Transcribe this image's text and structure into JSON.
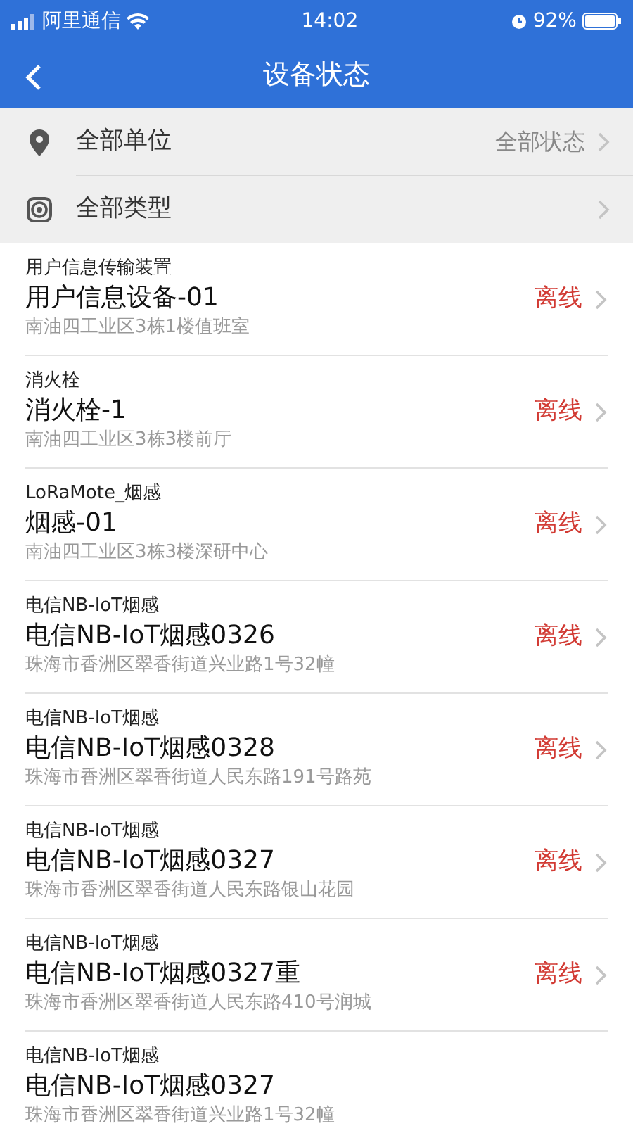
{
  "status_bar": {
    "carrier": "阿里通信",
    "time": "14:02",
    "battery": "92%"
  },
  "nav": {
    "title": "设备状态"
  },
  "filters": [
    {
      "kind": "location",
      "label": "全部单位",
      "value": "全部状态"
    },
    {
      "kind": "type",
      "label": "全部类型"
    }
  ],
  "devices": [
    {
      "type": "用户信息传输装置",
      "name": "用户信息设备-01",
      "address": "南油四工业区3栋1楼值班室",
      "status": "离线"
    },
    {
      "type": "消火栓",
      "name": "消火栓-1",
      "address": "南油四工业区3栋3楼前厅",
      "status": "离线"
    },
    {
      "type": "LoRaMote_烟感",
      "name": "烟感-01",
      "address": "南油四工业区3栋3楼深研中心",
      "status": "离线"
    },
    {
      "type": "电信NB-IoT烟感",
      "name": "电信NB-IoT烟感0326",
      "address": "珠海市香洲区翠香街道兴业路1号32幢",
      "status": "离线"
    },
    {
      "type": "电信NB-IoT烟感",
      "name": "电信NB-IoT烟感0328",
      "address": "珠海市香洲区翠香街道人民东路191号路苑",
      "status": "离线"
    },
    {
      "type": "电信NB-IoT烟感",
      "name": "电信NB-IoT烟感0327",
      "address": "珠海市香洲区翠香街道人民东路银山花园",
      "status": "离线"
    },
    {
      "type": "电信NB-IoT烟感",
      "name": "电信NB-IoT烟感0327重",
      "address": "珠海市香洲区翠香街道人民东路410号润城",
      "status": "离线"
    },
    {
      "type": "电信NB-IoT烟感",
      "name": "电信NB-IoT烟感0327",
      "address": "珠海市香洲区翠香街道兴业路1号32幢"
    }
  ]
}
